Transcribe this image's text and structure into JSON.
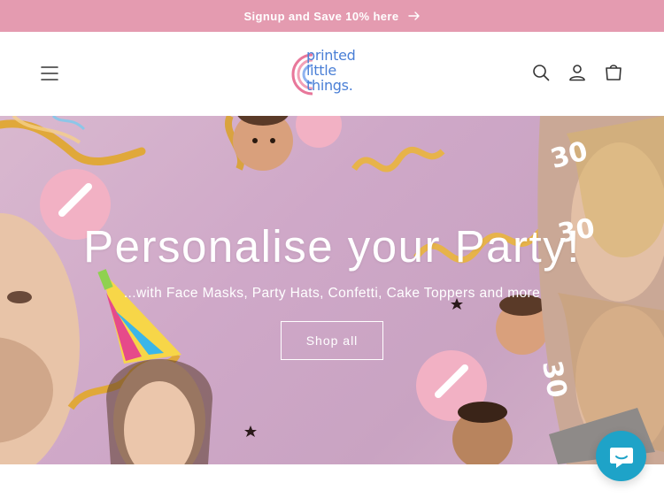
{
  "announcement": {
    "text": "Signup and Save 10% here",
    "icon": "arrow-right-icon",
    "bg": "#e49bb0"
  },
  "header": {
    "menu_icon": "hamburger-menu-icon",
    "logo": {
      "line1": "printed",
      "line2": "little",
      "line3": "things."
    },
    "icons": [
      "search-icon",
      "account-icon",
      "cart-icon"
    ]
  },
  "hero": {
    "title": "Personalise your Party!",
    "subtitle": "...with Face Masks, Party Hats, Confetti, Cake Toppers and more",
    "button": "Shop all",
    "decor_numbers": [
      "30",
      "30",
      "30"
    ]
  },
  "chat": {
    "icon": "chat-bubble-icon",
    "color": "#1ea3c8"
  }
}
